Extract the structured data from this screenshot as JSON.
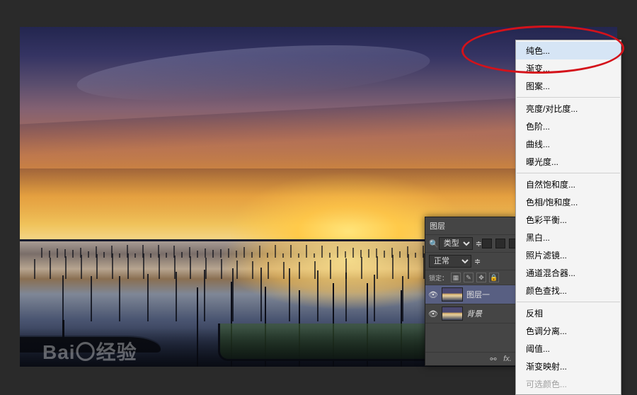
{
  "watermark": "Bai〇经验",
  "layers_panel": {
    "title": "图层",
    "type_label": "类型",
    "blend_mode": "正常",
    "lock_label": "锁定：",
    "items": [
      {
        "name": "图层一"
      },
      {
        "name": "背景"
      }
    ],
    "fx_label": "fx."
  },
  "menu": {
    "items": [
      {
        "label": "纯色...",
        "highlight": true
      },
      {
        "label": "渐变..."
      },
      {
        "label": "图案..."
      },
      {
        "sep": true
      },
      {
        "label": "亮度/对比度..."
      },
      {
        "label": "色阶..."
      },
      {
        "label": "曲线..."
      },
      {
        "label": "曝光度..."
      },
      {
        "sep": true
      },
      {
        "label": "自然饱和度..."
      },
      {
        "label": "色相/饱和度..."
      },
      {
        "label": "色彩平衡..."
      },
      {
        "label": "黑白..."
      },
      {
        "label": "照片滤镜..."
      },
      {
        "label": "通道混合器..."
      },
      {
        "label": "颜色查找..."
      },
      {
        "sep": true
      },
      {
        "label": "反相"
      },
      {
        "label": "色调分离..."
      },
      {
        "label": "阈值..."
      },
      {
        "label": "渐变映射..."
      },
      {
        "label": "可选颜色...",
        "disabled": true
      }
    ]
  }
}
